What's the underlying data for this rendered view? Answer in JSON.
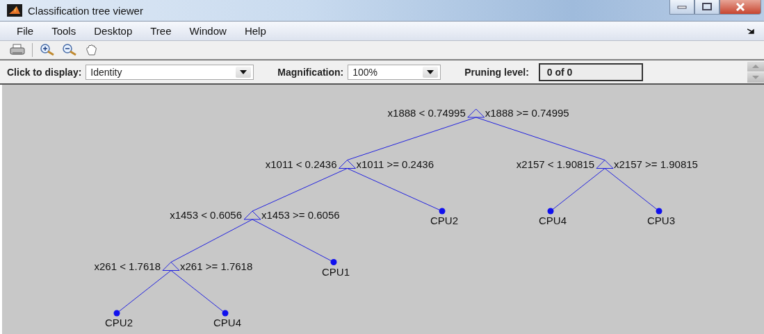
{
  "window": {
    "title": "Classification tree viewer"
  },
  "menu": [
    "File",
    "Tools",
    "Desktop",
    "Tree",
    "Window",
    "Help"
  ],
  "controls": {
    "display_label": "Click to display:",
    "display_value": "Identity",
    "magnification_label": "Magnification:",
    "magnification_value": "100%",
    "pruning_label": "Pruning level:",
    "pruning_value": "0 of 0"
  },
  "tree": {
    "left_rule": "x1888 < 0.74995",
    "right_rule": "x1888 >= 0.74995",
    "children": [
      {
        "left_rule": "x1011 < 0.2436",
        "right_rule": "x1011 >= 0.2436",
        "children": [
          {
            "left_rule": "x1453 < 0.6056",
            "right_rule": "x1453 >= 0.6056",
            "children": [
              {
                "left_rule": "x261 < 1.7618",
                "right_rule": "x261 >= 1.7618",
                "children": [
                  {
                    "label": "CPU2"
                  },
                  {
                    "label": "CPU4"
                  }
                ]
              },
              {
                "label": "CPU1"
              }
            ]
          },
          {
            "label": "CPU2"
          }
        ]
      },
      {
        "left_rule": "x2157 < 1.90815",
        "right_rule": "x2157 >= 1.90815",
        "children": [
          {
            "label": "CPU4"
          },
          {
            "label": "CPU3"
          }
        ]
      }
    ]
  }
}
